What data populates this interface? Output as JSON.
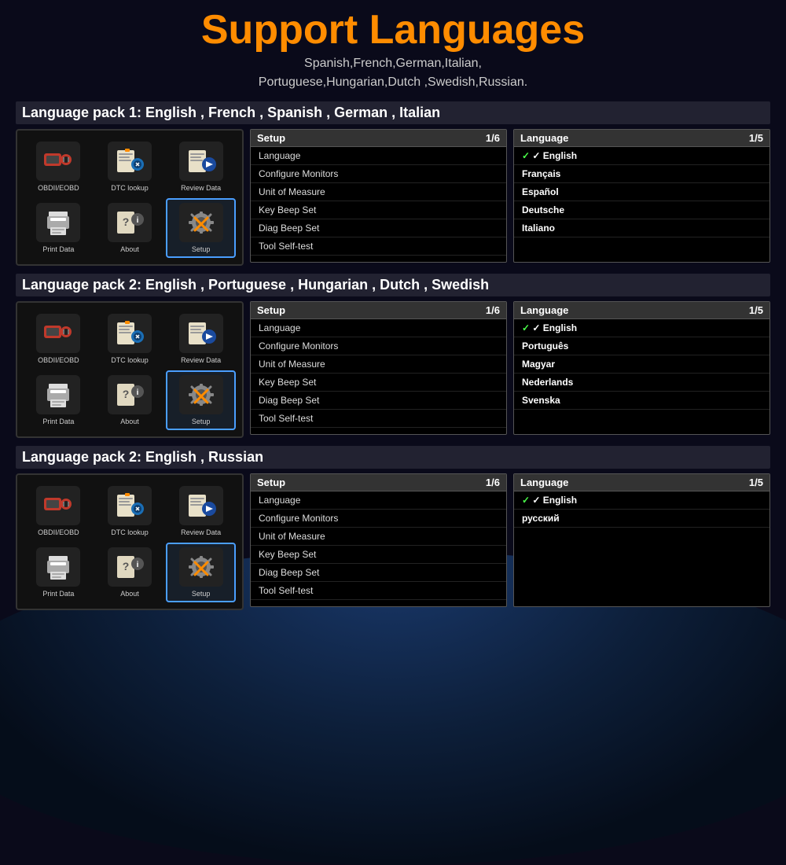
{
  "header": {
    "title_white": "Support ",
    "title_orange": "Languages",
    "subtitle_line1": "Spanish,French,German,Italian,",
    "subtitle_line2": "Portuguese,Hungarian,Dutch ,Swedish,Russian."
  },
  "packs": [
    {
      "id": "pack1",
      "title": "Language pack 1: English , French , Spanish , German , Italian",
      "setup_menu": {
        "header": "Setup",
        "page": "1/6",
        "items": [
          "Language",
          "Configure Monitors",
          "Unit of Measure",
          "Key Beep Set",
          "Diag Beep Set",
          "Tool Self-test"
        ]
      },
      "lang_menu": {
        "header": "Language",
        "page": "1/5",
        "items": [
          {
            "label": "English",
            "selected": true
          },
          {
            "label": "Français",
            "bold": true
          },
          {
            "label": "Español",
            "bold": true
          },
          {
            "label": "Deutsche",
            "bold": true
          },
          {
            "label": "Italiano",
            "bold": true
          }
        ]
      },
      "icons": [
        {
          "label": "OBDII/EOBD",
          "type": "obdii"
        },
        {
          "label": "DTC lookup",
          "type": "dtc"
        },
        {
          "label": "Review Data",
          "type": "review"
        },
        {
          "label": "Print Data",
          "type": "print"
        },
        {
          "label": "About",
          "type": "about"
        },
        {
          "label": "Setup",
          "type": "setup",
          "active": true
        }
      ]
    },
    {
      "id": "pack2",
      "title": "Language pack 2: English , Portuguese , Hungarian , Dutch , Swedish",
      "setup_menu": {
        "header": "Setup",
        "page": "1/6",
        "items": [
          "Language",
          "Configure Monitors",
          "Unit of Measure",
          "Key Beep Set",
          "Diag Beep Set",
          "Tool Self-test"
        ]
      },
      "lang_menu": {
        "header": "Language",
        "page": "1/5",
        "items": [
          {
            "label": "English",
            "selected": true
          },
          {
            "label": "Português",
            "bold": true
          },
          {
            "label": "Magyar",
            "bold": true
          },
          {
            "label": "Nederlands",
            "bold": true
          },
          {
            "label": "Svenska",
            "bold": true
          }
        ]
      },
      "icons": [
        {
          "label": "OBDII/EOBD",
          "type": "obdii"
        },
        {
          "label": "DTC lookup",
          "type": "dtc"
        },
        {
          "label": "Review Data",
          "type": "review"
        },
        {
          "label": "Print Data",
          "type": "print"
        },
        {
          "label": "About",
          "type": "about"
        },
        {
          "label": "Setup",
          "type": "setup",
          "active": true
        }
      ]
    },
    {
      "id": "pack3",
      "title": "Language pack 2: English , Russian",
      "setup_menu": {
        "header": "Setup",
        "page": "1/6",
        "items": [
          "Language",
          "Configure Monitors",
          "Unit of Measure",
          "Key Beep Set",
          "Diag Beep Set",
          "Tool Self-test"
        ]
      },
      "lang_menu": {
        "header": "Language",
        "page": "1/5",
        "items": [
          {
            "label": "English",
            "selected": true
          },
          {
            "label": "русский",
            "bold": true
          }
        ]
      },
      "icons": [
        {
          "label": "OBDII/EOBD",
          "type": "obdii"
        },
        {
          "label": "DTC lookup",
          "type": "dtc"
        },
        {
          "label": "Review Data",
          "type": "review"
        },
        {
          "label": "Print Data",
          "type": "print"
        },
        {
          "label": "About",
          "type": "about"
        },
        {
          "label": "Setup",
          "type": "setup",
          "active": true
        }
      ]
    }
  ]
}
